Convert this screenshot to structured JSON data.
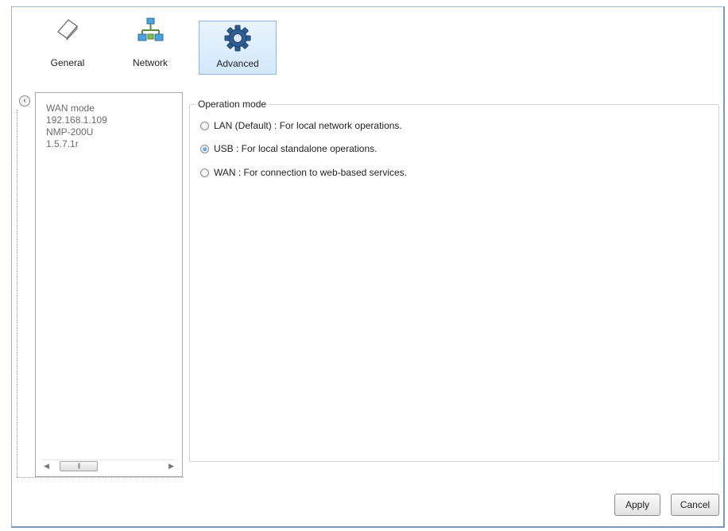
{
  "toolbar": {
    "items": [
      {
        "label": "General",
        "icon": "general-icon"
      },
      {
        "label": "Network",
        "icon": "network-icon"
      },
      {
        "label": "Advanced",
        "icon": "gear-icon"
      }
    ],
    "active": "Advanced"
  },
  "device_info": {
    "lines": [
      "WAN mode",
      "192.168.1.109",
      "NMP-200U",
      "1.5.7.1r"
    ]
  },
  "operation_mode": {
    "title": "Operation mode",
    "options": [
      {
        "label": "LAN (Default) : For local network operations.",
        "checked": false
      },
      {
        "label": "USB : For local standalone operations.",
        "checked": true
      },
      {
        "label": "WAN : For connection to web-based services.",
        "checked": false
      }
    ]
  },
  "buttons": {
    "apply": "Apply",
    "cancel": "Cancel"
  },
  "colors": {
    "active_tab_bg": "#d3e8fb",
    "radio_selected": "#1f6fc9",
    "window_border": "#9eb4cc"
  }
}
